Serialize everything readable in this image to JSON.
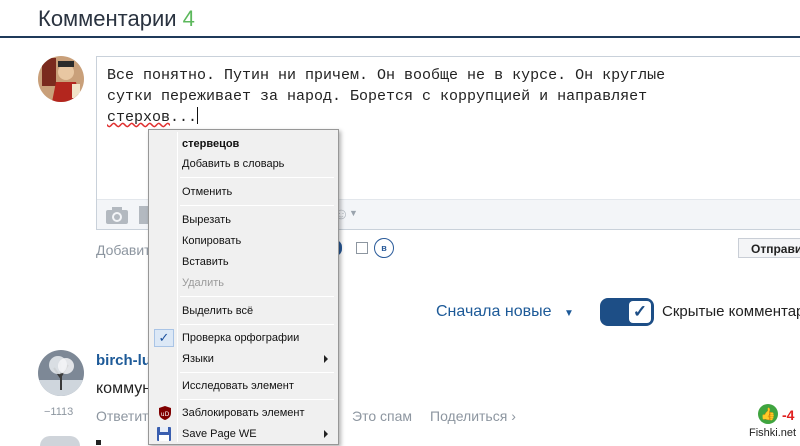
{
  "header": {
    "title": "Комментарии",
    "count": "4"
  },
  "editor": {
    "line1": "Все понятно. Путин ни причем. Он вообще не в курсе. Он круглые",
    "line2": "сутки переживает за народ. Борется с коррупцией и направляет",
    "misspelled_word": "стерхов",
    "trailing": "..."
  },
  "composer": {
    "add_label": "Добавить",
    "vk_badge": "в",
    "send_label": "Отправить"
  },
  "context_menu": {
    "suggestion": "стервецов",
    "add_to_dictionary": "Добавить в словарь",
    "undo": "Отменить",
    "cut": "Вырезать",
    "copy": "Копировать",
    "paste": "Вставить",
    "delete": "Удалить",
    "select_all": "Выделить всё",
    "spellcheck": "Проверка орфографии",
    "spellcheck_checked": true,
    "languages": "Языки",
    "inspect": "Исследовать элемент",
    "block_element": "Заблокировать элемент",
    "save_page": "Save Page WE",
    "check_glyph": "✓",
    "ublock_text": "uD"
  },
  "comments_bar": {
    "sort_label": "Сначала новые",
    "switch_glyph": "✓",
    "hidden_label": "Скрытые комментарии"
  },
  "comment": {
    "username": "birch-lu",
    "text": "коммун",
    "rating": "−1113",
    "reply": "Ответить",
    "spam": "Это спам",
    "share": "Поделиться ›",
    "score": "-4"
  },
  "watermark": "Fishki.net",
  "colors": {
    "accent": "#1d4e86",
    "link": "#1d5a98",
    "count_green": "#5cb85c",
    "score_red": "#e02020"
  }
}
